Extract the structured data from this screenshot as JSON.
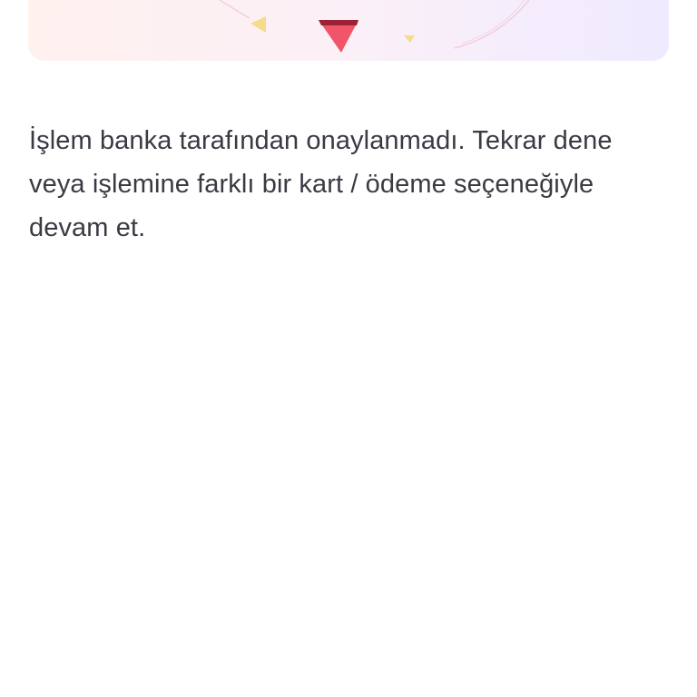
{
  "message": {
    "text": "İşlem banka tarafından onaylanmadı. Tekrar dene veya işlemine farklı bir kart / ödeme seçeneğiyle devam et."
  },
  "hero": {
    "illustration": "confetti-illustration",
    "colors": {
      "background_start": "#fff1ee",
      "background_end": "#efeaff",
      "red_triangle": "#f0556a",
      "yellow_triangle": "#f6dc8a"
    }
  }
}
